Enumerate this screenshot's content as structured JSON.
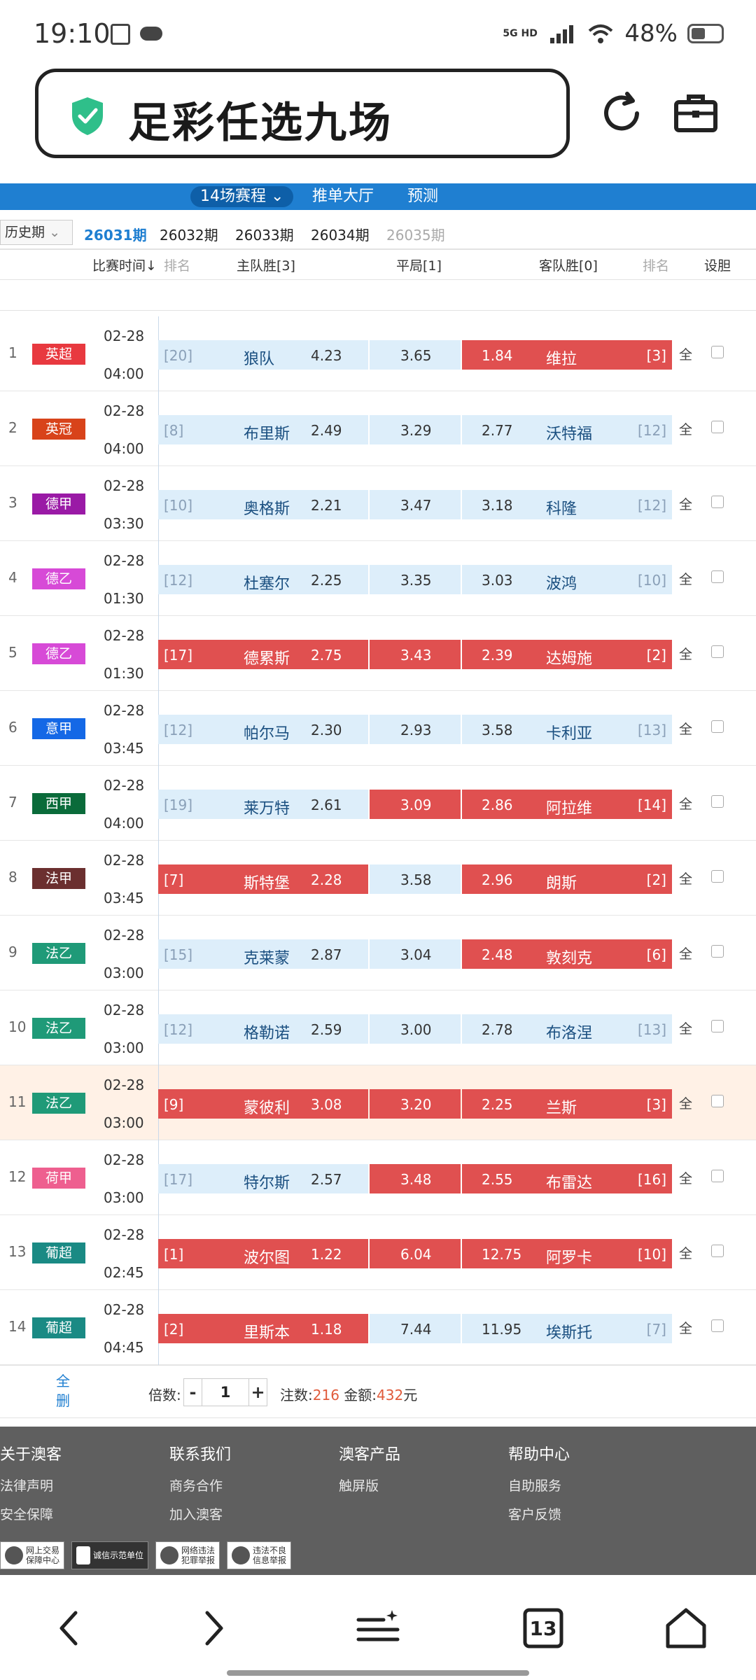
{
  "status_bar": {
    "time": "19:10",
    "network": "5G HD",
    "battery": "48%",
    "battery_level": 0.48
  },
  "address_bar": {
    "title": "足彩任选九场"
  },
  "top_nav": {
    "tabs": [
      "14场赛程",
      "推单大厅",
      "预测"
    ],
    "active_tab_arrow": "chevron-down-icon"
  },
  "period_bar": {
    "history_label": "历史期",
    "periods": [
      "26031期",
      "26032期",
      "26033期",
      "26034期",
      "26035期"
    ],
    "active_index": 0
  },
  "table_header": {
    "time": "比赛时间↓",
    "rank_left": "排名",
    "home": "主队胜[3]",
    "draw": "平局[1]",
    "away": "客队胜[0]",
    "rank_right": "排名",
    "banker": "设胆"
  },
  "colors": {
    "selected": "#e05050",
    "unselected": "#ddeefa",
    "nav_blue": "#1f7fd1",
    "highlight_row": "#fff1e6"
  },
  "matches": [
    {
      "no": "1",
      "league": "英超",
      "league_color": "#e8393f",
      "date": "02-28",
      "time": "04:00",
      "home_rank": "[20]",
      "home": "狼队",
      "home_odds": "4.23",
      "draw_odds": "3.65",
      "away_odds": "1.84",
      "away": "维拉",
      "away_rank": "[3]",
      "sel": [
        false,
        false,
        true
      ],
      "all": "全"
    },
    {
      "no": "2",
      "league": "英冠",
      "league_color": "#d8431a",
      "date": "02-28",
      "time": "04:00",
      "home_rank": "[8]",
      "home": "布里斯",
      "home_odds": "2.49",
      "draw_odds": "3.29",
      "away_odds": "2.77",
      "away": "沃特福",
      "away_rank": "[12]",
      "sel": [
        false,
        false,
        false
      ],
      "all": "全"
    },
    {
      "no": "3",
      "league": "德甲",
      "league_color": "#9a1aa6",
      "date": "02-28",
      "time": "03:30",
      "home_rank": "[10]",
      "home": "奥格斯",
      "home_odds": "2.21",
      "draw_odds": "3.47",
      "away_odds": "3.18",
      "away": "科隆",
      "away_rank": "[12]",
      "sel": [
        false,
        false,
        false
      ],
      "all": "全"
    },
    {
      "no": "4",
      "league": "德乙",
      "league_color": "#d74ad7",
      "date": "02-28",
      "time": "01:30",
      "home_rank": "[12]",
      "home": "杜塞尔",
      "home_odds": "2.25",
      "draw_odds": "3.35",
      "away_odds": "3.03",
      "away": "波鸿",
      "away_rank": "[10]",
      "sel": [
        false,
        false,
        false
      ],
      "all": "全"
    },
    {
      "no": "5",
      "league": "德乙",
      "league_color": "#d74ad7",
      "date": "02-28",
      "time": "01:30",
      "home_rank": "[17]",
      "home": "德累斯",
      "home_odds": "2.75",
      "draw_odds": "3.43",
      "away_odds": "2.39",
      "away": "达姆施",
      "away_rank": "[2]",
      "sel": [
        true,
        true,
        true
      ],
      "all": "全"
    },
    {
      "no": "6",
      "league": "意甲",
      "league_color": "#1468e6",
      "date": "02-28",
      "time": "03:45",
      "home_rank": "[12]",
      "home": "帕尔马",
      "home_odds": "2.30",
      "draw_odds": "2.93",
      "away_odds": "3.58",
      "away": "卡利亚",
      "away_rank": "[13]",
      "sel": [
        false,
        false,
        false
      ],
      "all": "全"
    },
    {
      "no": "7",
      "league": "西甲",
      "league_color": "#0a6b3a",
      "date": "02-28",
      "time": "04:00",
      "home_rank": "[19]",
      "home": "莱万特",
      "home_odds": "2.61",
      "draw_odds": "3.09",
      "away_odds": "2.86",
      "away": "阿拉维",
      "away_rank": "[14]",
      "sel": [
        false,
        true,
        true
      ],
      "all": "全"
    },
    {
      "no": "8",
      "league": "法甲",
      "league_color": "#6b2f2f",
      "date": "02-28",
      "time": "03:45",
      "home_rank": "[7]",
      "home": "斯特堡",
      "home_odds": "2.28",
      "draw_odds": "3.58",
      "away_odds": "2.96",
      "away": "朗斯",
      "away_rank": "[2]",
      "sel": [
        true,
        false,
        true
      ],
      "all": "全"
    },
    {
      "no": "9",
      "league": "法乙",
      "league_color": "#1f9a78",
      "date": "02-28",
      "time": "03:00",
      "home_rank": "[15]",
      "home": "克莱蒙",
      "home_odds": "2.87",
      "draw_odds": "3.04",
      "away_odds": "2.48",
      "away": "敦刻克",
      "away_rank": "[6]",
      "sel": [
        false,
        false,
        true
      ],
      "all": "全"
    },
    {
      "no": "10",
      "league": "法乙",
      "league_color": "#1f9a78",
      "date": "02-28",
      "time": "03:00",
      "home_rank": "[12]",
      "home": "格勒诺",
      "home_odds": "2.59",
      "draw_odds": "3.00",
      "away_odds": "2.78",
      "away": "布洛涅",
      "away_rank": "[13]",
      "sel": [
        false,
        false,
        false
      ],
      "all": "全"
    },
    {
      "no": "11",
      "league": "法乙",
      "league_color": "#1f9a78",
      "date": "02-28",
      "time": "03:00",
      "home_rank": "[9]",
      "home": "蒙彼利",
      "home_odds": "3.08",
      "draw_odds": "3.20",
      "away_odds": "2.25",
      "away": "兰斯",
      "away_rank": "[3]",
      "sel": [
        true,
        true,
        true
      ],
      "all": "全",
      "highlight": true
    },
    {
      "no": "12",
      "league": "荷甲",
      "league_color": "#ee5f8f",
      "date": "02-28",
      "time": "03:00",
      "home_rank": "[17]",
      "home": "特尔斯",
      "home_odds": "2.57",
      "draw_odds": "3.48",
      "away_odds": "2.55",
      "away": "布雷达",
      "away_rank": "[16]",
      "sel": [
        false,
        true,
        true
      ],
      "all": "全"
    },
    {
      "no": "13",
      "league": "葡超",
      "league_color": "#1a8a84",
      "date": "02-28",
      "time": "02:45",
      "home_rank": "[1]",
      "home": "波尔图",
      "home_odds": "1.22",
      "draw_odds": "6.04",
      "away_odds": "12.75",
      "away": "阿罗卡",
      "away_rank": "[10]",
      "sel": [
        true,
        true,
        true
      ],
      "all": "全"
    },
    {
      "no": "14",
      "league": "葡超",
      "league_color": "#1a8a84",
      "date": "02-28",
      "time": "04:45",
      "home_rank": "[2]",
      "home": "里斯本",
      "home_odds": "1.18",
      "draw_odds": "7.44",
      "away_odds": "11.95",
      "away": "埃斯托",
      "away_rank": "[7]",
      "sel": [
        true,
        false,
        false
      ],
      "all": "全"
    }
  ],
  "bet_bar": {
    "clear_label": "全删",
    "multiplier_label": "倍数:",
    "minus": "-",
    "plus": "+",
    "multiplier_value": "1",
    "bets_label": "注数:",
    "bets_value": "216",
    "amount_label": "金额:",
    "amount_value": "432",
    "amount_unit": "元"
  },
  "footer": {
    "columns": [
      {
        "title": "关于澳客",
        "items": [
          "法律声明",
          "安全保障"
        ]
      },
      {
        "title": "联系我们",
        "items": [
          "商务合作",
          "加入澳客"
        ]
      },
      {
        "title": "澳客产品",
        "items": [
          "触屏版"
        ]
      },
      {
        "title": "帮助中心",
        "items": [
          "自助服务",
          "客户反馈"
        ]
      }
    ],
    "badges": [
      [
        "网上交易",
        "保障中心"
      ],
      [
        "诚信示范单位",
        ""
      ],
      [
        "网络违法",
        "犯罪举报"
      ],
      [
        "违法不良",
        "信息举报"
      ]
    ]
  },
  "bottom_nav": {
    "tab_count": "13",
    "icons": [
      "back-arrow-icon",
      "forward-arrow-icon",
      "menu-icon",
      "tabs-icon",
      "home-icon"
    ]
  }
}
